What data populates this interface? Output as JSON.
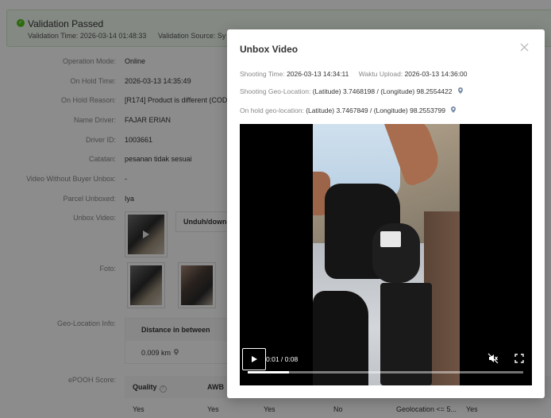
{
  "banner": {
    "title": "Validation Passed",
    "validation_time": "Validation Time: 2026-03-14 01:48:33",
    "validation_source": "Validation Source: Sy"
  },
  "details": [
    {
      "label": "Operation Mode:",
      "value": "Online"
    },
    {
      "label": "On Hold Time:",
      "value": "2026-03-13 14:35:49"
    },
    {
      "label": "On Hold Reason:",
      "value": "[R174] Product is different (COD"
    },
    {
      "label": "Name Driver:",
      "value": "FAJAR ERIAN"
    },
    {
      "label": "Driver ID:",
      "value": "1003661"
    },
    {
      "label": "Catatan:",
      "value": "pesanan tidak sesuai"
    },
    {
      "label": "Video Without Buyer Unbox:",
      "value": "-"
    },
    {
      "label": "Parcel Unboxed:",
      "value": "Iya"
    },
    {
      "label": "Unbox Video:",
      "value": ""
    },
    {
      "label": "Foto:",
      "value": ""
    },
    {
      "label": "Geo-Location Info:",
      "value": ""
    },
    {
      "label": "ePOOH Score:",
      "value": ""
    }
  ],
  "unbox_video_download": "Unduh/downl",
  "geo_table": {
    "header": "Distance in between",
    "value": "0.009 km"
  },
  "epooh": {
    "headers": [
      "Quality",
      "AWB"
    ],
    "values": [
      "Yes",
      "Yes",
      "Yes",
      "No",
      "Geolocation <= 5...",
      "Yes"
    ]
  },
  "modal": {
    "title": "Unbox Video",
    "shooting_time_label": "Shooting Time:",
    "shooting_time": "2026-03-13 14:34:11",
    "upload_label": "Waktu Upload:",
    "upload_time": "2026-03-13 14:36:00",
    "shooting_geo_label": "Shooting Geo-Location:",
    "shooting_geo": "(Latitude) 3.7468198 / (Longitude) 98.2554422",
    "onhold_geo_label": "On hold geo-location:",
    "onhold_geo": "(Latitude) 3.7467849 / (Longitude) 98.2553799"
  },
  "video": {
    "time_display": "0:01 / 0:08",
    "progress": 0.15
  },
  "colors": {
    "success": "#52c41a",
    "pin": "#7a8ea8"
  }
}
